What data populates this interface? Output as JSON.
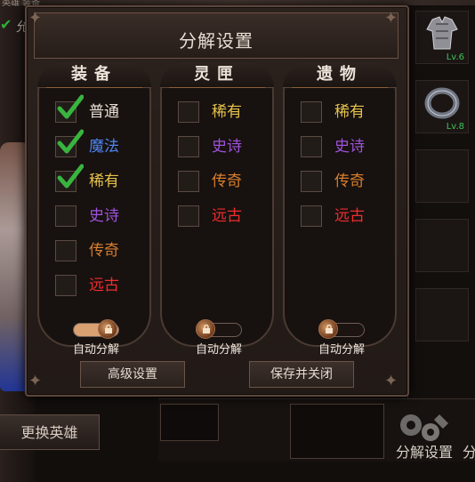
{
  "background": {
    "top_text": "英雄 装备",
    "top_char": "允"
  },
  "inventory": {
    "slots": [
      {
        "level": "Lv.6",
        "item": "armor"
      },
      {
        "level": "Lv.8",
        "item": "ring"
      }
    ]
  },
  "buttons": {
    "change_hero": "更换英雄",
    "decompose_settings": "分解设置",
    "decompose_settings_partial": "分"
  },
  "dialog": {
    "title": "分解设置",
    "columns": [
      {
        "title": "装备",
        "items": [
          {
            "label": "普通",
            "checked": true,
            "color": "#e9e1d7"
          },
          {
            "label": "魔法",
            "checked": true,
            "color": "#4f85f1"
          },
          {
            "label": "稀有",
            "checked": true,
            "color": "#e7c34b"
          },
          {
            "label": "史诗",
            "checked": false,
            "color": "#9f52db"
          },
          {
            "label": "传奇",
            "checked": false,
            "color": "#d97f2e"
          },
          {
            "label": "远古",
            "checked": false,
            "color": "#ef2d2d"
          }
        ],
        "toggle_label": "自动分解",
        "toggle_on": true
      },
      {
        "title": "灵匣",
        "items": [
          {
            "label": "稀有",
            "checked": false,
            "color": "#e7c34b"
          },
          {
            "label": "史诗",
            "checked": false,
            "color": "#9f52db"
          },
          {
            "label": "传奇",
            "checked": false,
            "color": "#d97f2e"
          },
          {
            "label": "远古",
            "checked": false,
            "color": "#ef2d2d"
          }
        ],
        "toggle_label": "自动分解",
        "toggle_on": false
      },
      {
        "title": "遗物",
        "items": [
          {
            "label": "稀有",
            "checked": false,
            "color": "#e7c34b"
          },
          {
            "label": "史诗",
            "checked": false,
            "color": "#9f52db"
          },
          {
            "label": "传奇",
            "checked": false,
            "color": "#d97f2e"
          },
          {
            "label": "远古",
            "checked": false,
            "color": "#ef2d2d"
          }
        ],
        "toggle_label": "自动分解",
        "toggle_on": false
      }
    ],
    "advanced_button": "高级设置",
    "save_button": "保存并关闭"
  }
}
